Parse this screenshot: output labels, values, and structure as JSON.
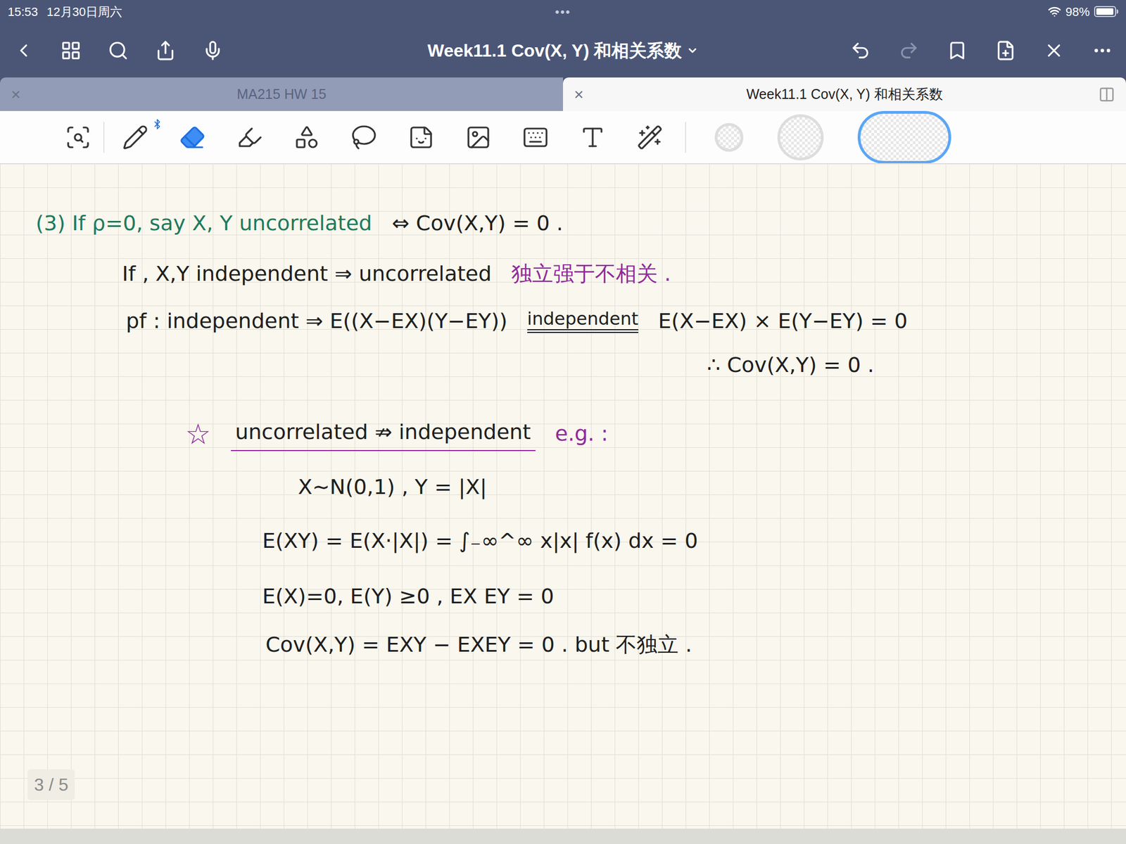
{
  "status_bar": {
    "time": "15:53",
    "date": "12月30日周六",
    "dots": "•••",
    "battery": "98%",
    "battery_level": 0.98
  },
  "nav": {
    "title": "Week11.1 Cov(X, Y) 和相关系数",
    "left_buttons": [
      {
        "kind": "back",
        "disabled": false
      },
      {
        "kind": "grid",
        "disabled": false
      },
      {
        "kind": "search",
        "disabled": false
      },
      {
        "kind": "share",
        "disabled": false
      },
      {
        "kind": "mic",
        "disabled": false
      }
    ],
    "right_buttons": [
      {
        "kind": "undo",
        "disabled": false
      },
      {
        "kind": "redo",
        "disabled": true
      },
      {
        "kind": "bookmark",
        "disabled": false
      },
      {
        "kind": "add-page",
        "disabled": false
      },
      {
        "kind": "close",
        "disabled": false
      },
      {
        "kind": "more",
        "disabled": false
      }
    ]
  },
  "tabs": [
    {
      "label": "MA215 HW 15",
      "selected": false,
      "close": "×"
    },
    {
      "label": "Week11.1 Cov(X, Y) 和相关系数",
      "selected": true,
      "close": "×"
    }
  ],
  "toolbar": {
    "tools": [
      {
        "kind": "zoom",
        "selected": false
      },
      {
        "kind": "pen",
        "selected": false
      },
      {
        "kind": "eraser",
        "selected": true
      },
      {
        "kind": "highlighter",
        "selected": false
      },
      {
        "kind": "shapes",
        "selected": false
      },
      {
        "kind": "lasso",
        "selected": false
      },
      {
        "kind": "sticker",
        "selected": false
      },
      {
        "kind": "image",
        "selected": false
      },
      {
        "kind": "keyboard",
        "selected": false
      },
      {
        "kind": "text",
        "selected": false
      },
      {
        "kind": "laser",
        "selected": false
      }
    ],
    "swatches": [
      {
        "selected": false
      },
      {
        "selected": false
      },
      {
        "selected": true
      }
    ]
  },
  "page": {
    "indicator": "3 / 5",
    "notes": [
      [
        {
          "text": "(3) If ρ=0, say X, Y uncorrelated",
          "kind": "text",
          "color": "#1f7a5c"
        },
        {
          "text": "⇔ Cov(X,Y) = 0 .",
          "kind": "text",
          "color": "#1e1e1e"
        }
      ],
      [
        {
          "text": "If , X,Y independent ⇒ uncorrelated",
          "kind": "text",
          "color": "#1e1e1e"
        },
        {
          "text": "独立强于不相关 .",
          "kind": "text",
          "color": "#8e2a9a"
        }
      ],
      [
        {
          "text": "pf :  independent ⇒ E((X−EX)(Y−EY))",
          "kind": "text",
          "color": "#1e1e1e"
        },
        {
          "text": "independent",
          "kind": "over",
          "color": "#1e1e1e"
        },
        {
          "text": "E(X−EX) × E(Y−EY) = 0",
          "kind": "text",
          "color": "#1e1e1e"
        }
      ],
      [
        {
          "text": "∴ Cov(X,Y) = 0 .",
          "kind": "text",
          "color": "#1e1e1e"
        }
      ],
      [
        {
          "text": "☆",
          "kind": "star",
          "color": "#8e2a9a"
        },
        {
          "text": "uncorrelated ⇏ independent",
          "kind": "underline",
          "color": "#1e1e1e"
        },
        {
          "text": "e.g. :",
          "kind": "text",
          "color": "#8e2a9a"
        }
      ],
      [
        {
          "text": "X∼N(0,1) ,  Y = |X|",
          "kind": "text",
          "color": "#1e1e1e"
        }
      ],
      [
        {
          "text": "E(XY) = E(X·|X|) = ∫₋∞^∞ x|x| f(x) dx = 0",
          "kind": "text",
          "color": "#1e1e1e"
        }
      ],
      [
        {
          "text": "E(X)=0,  E(Y) ≥0 ,  EX EY = 0",
          "kind": "text",
          "color": "#1e1e1e"
        }
      ],
      [
        {
          "text": "Cov(X,Y) = EXY − EXEY = 0 .  but 不独立 .",
          "kind": "text",
          "color": "#1e1e1e"
        }
      ]
    ]
  }
}
